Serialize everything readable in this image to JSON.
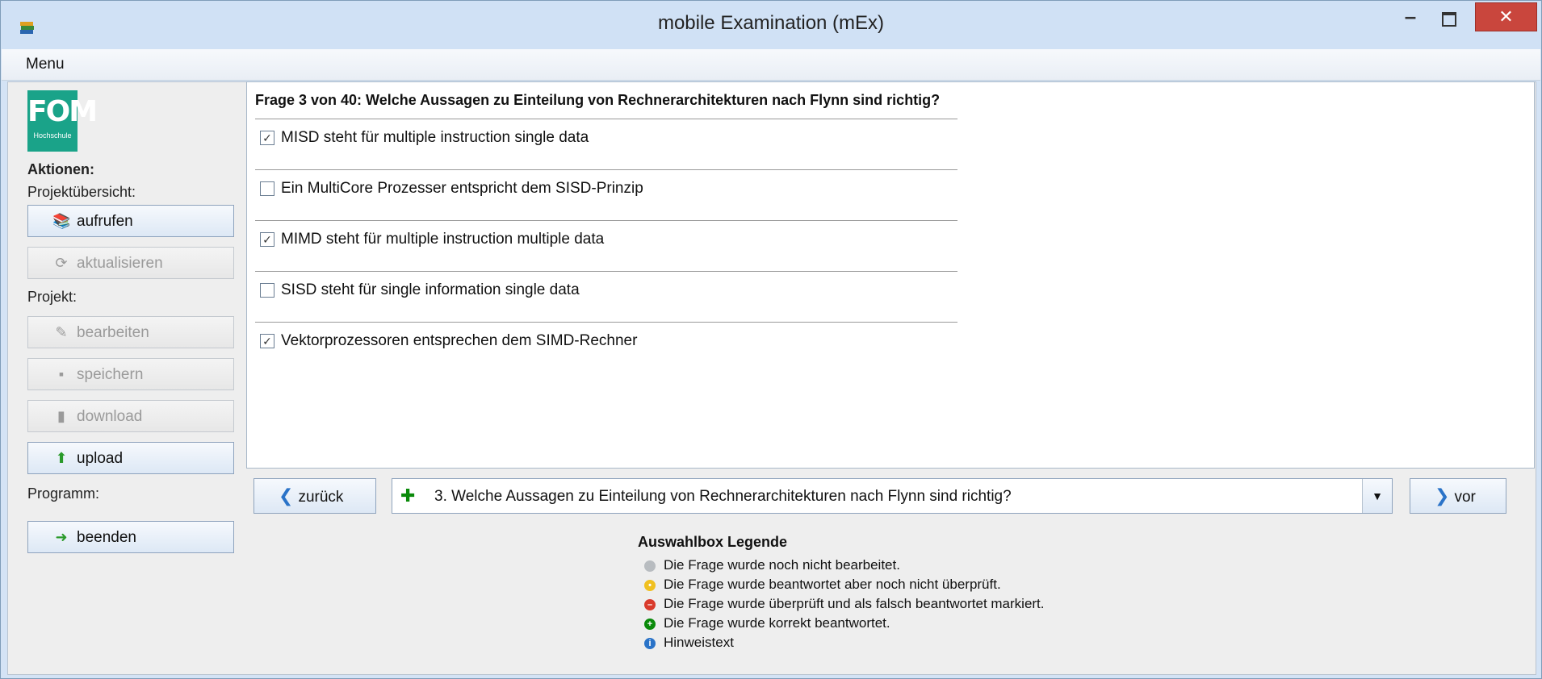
{
  "window": {
    "title": "mobile Examination (mEx)",
    "min": "–",
    "close": "✕"
  },
  "menu": {
    "label": "Menu"
  },
  "sidebar": {
    "logo_text": "FOM",
    "logo_sub": "Hochschule",
    "aktionen": "Aktionen:",
    "projektuebersicht": "Projektübersicht:",
    "aufrufen": "aufrufen",
    "aktualisieren": "aktualisieren",
    "projekt": "Projekt:",
    "bearbeiten": "bearbeiten",
    "speichern": "speichern",
    "download": "download",
    "upload": "upload",
    "programm": "Programm:",
    "beenden": "beenden"
  },
  "question": {
    "title": "Frage 3 von 40: Welche Aussagen zu Einteilung von Rechnerarchitekturen nach Flynn sind richtig?",
    "options": [
      {
        "label": "MISD steht für multiple instruction single data",
        "checked": true
      },
      {
        "label": "Ein MultiCore Prozesser entspricht dem SISD-Prinzip",
        "checked": false
      },
      {
        "label": "MIMD steht für multiple instruction multiple data",
        "checked": true
      },
      {
        "label": "SISD steht für single information single data",
        "checked": false
      },
      {
        "label": "Vektorprozessoren entsprechen dem SIMD-Rechner",
        "checked": true
      }
    ]
  },
  "nav": {
    "back": "zurück",
    "next": "vor",
    "selected": "3. Welche Aussagen zu Einteilung von Rechnerarchitekturen nach Flynn sind richtig?"
  },
  "legend": {
    "title": "Auswahlbox Legende",
    "items": [
      {
        "text": "Die Frage wurde noch nicht bearbeitet.",
        "color": "#b8bcc0",
        "symbol": ""
      },
      {
        "text": "Die Frage wurde beantwortet aber noch nicht überprüft.",
        "color": "#f0c020",
        "symbol": "•"
      },
      {
        "text": "Die Frage wurde überprüft und als falsch beantwortet markiert.",
        "color": "#d93a2b",
        "symbol": "–"
      },
      {
        "text": "Die Frage wurde korrekt beantwortet.",
        "color": "#0a8a0a",
        "symbol": "+"
      },
      {
        "text": "Hinweistext",
        "color": "#2a73c8",
        "symbol": "i"
      }
    ]
  }
}
